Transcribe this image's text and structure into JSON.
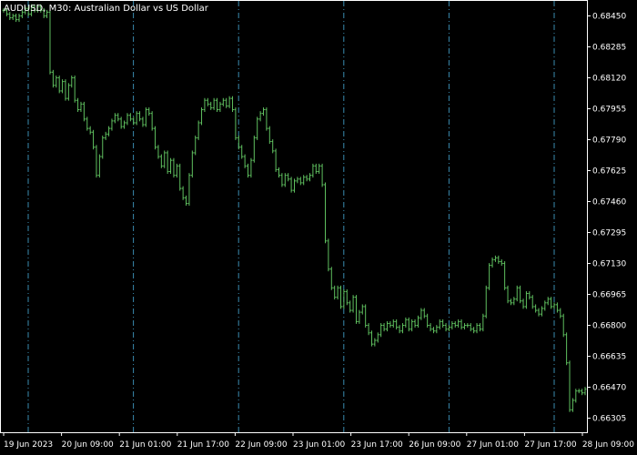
{
  "header": {
    "symbol": "AUDUSD",
    "timeframe": "M30",
    "description": "Australian Dollar vs US Dollar"
  },
  "colors": {
    "background": "#000000",
    "candle": "#5fbf5f",
    "grid_separator": "#3a8bb0",
    "axis": "#ffffff"
  },
  "chart_data": {
    "type": "line",
    "style": "ohlc-bars",
    "y_ticks": [
      "0.68450",
      "0.68285",
      "0.68120",
      "0.67955",
      "0.67790",
      "0.67625",
      "0.67460",
      "0.67295",
      "0.67130",
      "0.66965",
      "0.66800",
      "0.66635",
      "0.66470",
      "0.66305"
    ],
    "x_ticks": [
      "19 Jun 2023",
      "20 Jun 09:00",
      "21 Jun 01:00",
      "21 Jun 17:00",
      "22 Jun 09:00",
      "23 Jun 01:00",
      "23 Jun 17:00",
      "26 Jun 09:00",
      "27 Jun 01:00",
      "27 Jun 17:00",
      "28 Jun 09:00"
    ],
    "ylim": [
      0.6623,
      0.6853
    ],
    "grid": false,
    "day_separators": 6,
    "series": [
      {
        "values": [
          0.6848,
          0.6846,
          0.6844,
          0.6845,
          0.6843,
          0.6845,
          0.6847,
          0.6849,
          0.6846,
          0.685,
          0.6848,
          0.685,
          0.6848,
          0.6845,
          0.6847,
          0.6815,
          0.6808,
          0.6812,
          0.6805,
          0.681,
          0.6801,
          0.6808,
          0.6812,
          0.68,
          0.6795,
          0.6798,
          0.679,
          0.6785,
          0.6783,
          0.6775,
          0.676,
          0.677,
          0.678,
          0.6782,
          0.6785,
          0.6789,
          0.6792,
          0.679,
          0.6786,
          0.6788,
          0.6792,
          0.679,
          0.6788,
          0.6793,
          0.679,
          0.6787,
          0.6795,
          0.6793,
          0.6785,
          0.6775,
          0.677,
          0.6765,
          0.6772,
          0.6762,
          0.6768,
          0.676,
          0.6765,
          0.6753,
          0.6748,
          0.6745,
          0.676,
          0.6772,
          0.678,
          0.6788,
          0.6795,
          0.68,
          0.6798,
          0.6796,
          0.68,
          0.6795,
          0.6798,
          0.68,
          0.6797,
          0.6801,
          0.6795,
          0.678,
          0.6775,
          0.677,
          0.6765,
          0.676,
          0.6768,
          0.678,
          0.679,
          0.6793,
          0.6795,
          0.6785,
          0.6778,
          0.6773,
          0.6763,
          0.676,
          0.6755,
          0.676,
          0.6758,
          0.6752,
          0.6757,
          0.6758,
          0.6756,
          0.6759,
          0.6758,
          0.676,
          0.6765,
          0.6762,
          0.6765,
          0.6755,
          0.6725,
          0.671,
          0.67,
          0.6695,
          0.67,
          0.669,
          0.6698,
          0.6692,
          0.6688,
          0.6695,
          0.6682,
          0.6687,
          0.669,
          0.668,
          0.6676,
          0.667,
          0.6672,
          0.6675,
          0.668,
          0.6678,
          0.6681,
          0.668,
          0.6682,
          0.6679,
          0.6677,
          0.668,
          0.6683,
          0.6678,
          0.6682,
          0.668,
          0.6684,
          0.6688,
          0.6685,
          0.668,
          0.6678,
          0.6677,
          0.6679,
          0.6682,
          0.668,
          0.6678,
          0.6679,
          0.6681,
          0.668,
          0.6682,
          0.6679,
          0.668,
          0.668,
          0.6678,
          0.6677,
          0.668,
          0.6678,
          0.6685,
          0.67,
          0.6712,
          0.6715,
          0.6716,
          0.6714,
          0.6713,
          0.67,
          0.6693,
          0.6692,
          0.6694,
          0.67,
          0.6693,
          0.669,
          0.6697,
          0.6695,
          0.669,
          0.6688,
          0.6686,
          0.6689,
          0.6692,
          0.6694,
          0.669,
          0.6691,
          0.6688,
          0.6685,
          0.6675,
          0.666,
          0.6635,
          0.664,
          0.6645,
          0.6645,
          0.6644,
          0.6646
        ]
      }
    ]
  }
}
